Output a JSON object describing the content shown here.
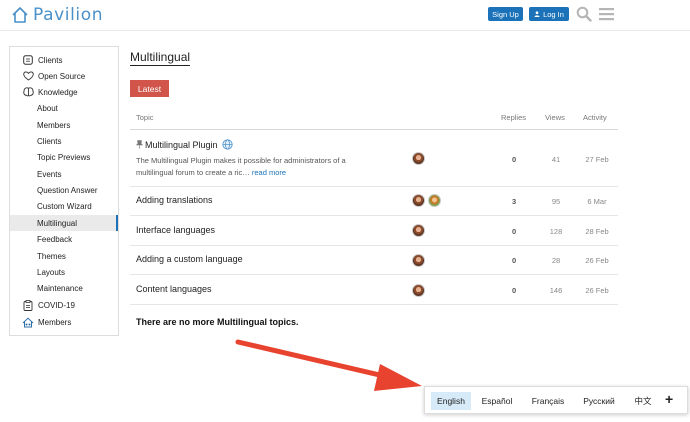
{
  "header": {
    "logo_text": "Pavilion",
    "signup_label": "Sign Up",
    "login_label": "Log In",
    "brand_color": "#4a90c9",
    "button_color": "#1b72b8"
  },
  "sidebar": {
    "items": [
      {
        "label": "Clients",
        "icon": "clients-icon",
        "level": "top"
      },
      {
        "label": "Open Source",
        "icon": "heart-icon",
        "level": "top"
      },
      {
        "label": "Knowledge",
        "icon": "brain-icon",
        "level": "top"
      },
      {
        "label": "About",
        "level": "sub"
      },
      {
        "label": "Members",
        "level": "sub"
      },
      {
        "label": "Clients",
        "level": "sub"
      },
      {
        "label": "Topic Previews",
        "level": "sub"
      },
      {
        "label": "Events",
        "level": "sub"
      },
      {
        "label": "Question Answer",
        "level": "sub"
      },
      {
        "label": "Custom Wizard",
        "level": "sub"
      },
      {
        "label": "Multilingual",
        "level": "sub",
        "active": true
      },
      {
        "label": "Feedback",
        "level": "sub"
      },
      {
        "label": "Themes",
        "level": "sub"
      },
      {
        "label": "Layouts",
        "level": "sub"
      },
      {
        "label": "Maintenance",
        "level": "sub"
      },
      {
        "label": "COVID-19",
        "icon": "clipboard-icon",
        "level": "top"
      },
      {
        "label": "Members",
        "icon": "house-icon",
        "level": "top"
      }
    ],
    "active_color": "#1b72b8"
  },
  "main": {
    "title": "Multilingual",
    "tab_latest": "Latest",
    "tab_color": "#d1554a",
    "columns": {
      "topic": "Topic",
      "replies": "Replies",
      "views": "Views",
      "activity": "Activity"
    },
    "topics": [
      {
        "title": "Multilingual Plugin",
        "pinned": true,
        "excerpt": "The Multilingual Plugin makes it possible for administrators of a multilingual forum to create a ric…",
        "read_more": "read more",
        "replies": "0",
        "views": "41",
        "activity": "27 Feb"
      },
      {
        "title": "Adding translations",
        "replies": "3",
        "views": "95",
        "activity": "6 Mar"
      },
      {
        "title": "Interface languages",
        "replies": "0",
        "views": "128",
        "activity": "28 Feb"
      },
      {
        "title": "Adding a custom language",
        "replies": "0",
        "views": "28",
        "activity": "26 Feb"
      },
      {
        "title": "Content languages",
        "replies": "0",
        "views": "146",
        "activity": "26 Feb"
      }
    ],
    "no_more": "There are no more Multilingual topics."
  },
  "language_switcher": {
    "languages": [
      "English",
      "Español",
      "Français",
      "Русский",
      "中文"
    ],
    "active": "English",
    "add_label": "+",
    "active_bg": "#d6eaf8"
  },
  "annotation": {
    "arrow_color": "#e8432f"
  }
}
